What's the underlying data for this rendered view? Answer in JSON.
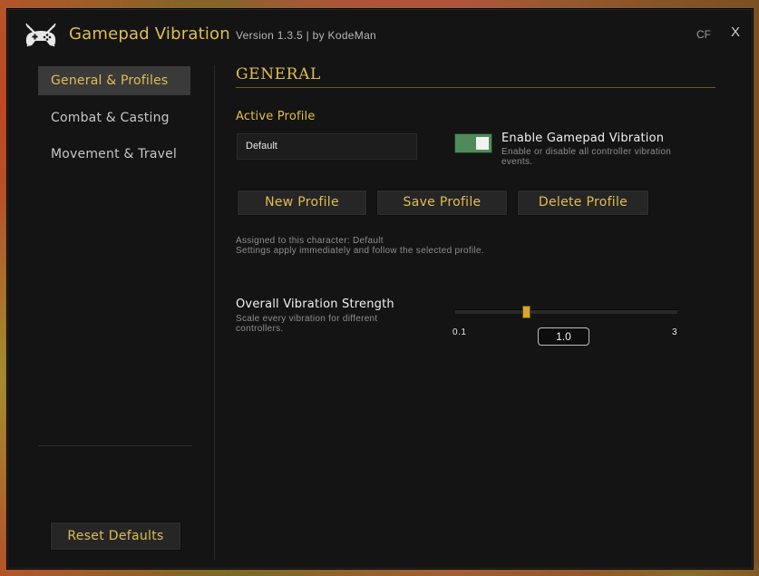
{
  "window": {
    "title": "Gamepad Vibration",
    "version": "Version 1.3.5  |  by KodeMan",
    "cf_label": "CF",
    "close_label": "X"
  },
  "sidebar": {
    "items": [
      {
        "label": "General & Profiles",
        "active": true
      },
      {
        "label": "Combat & Casting",
        "active": false
      },
      {
        "label": "Movement & Travel",
        "active": false
      }
    ],
    "reset_label": "Reset Defaults"
  },
  "main": {
    "section_title": "GENERAL",
    "active_profile_label": "Active Profile",
    "profile_value": "Default",
    "toggle": {
      "title": "Enable Gamepad Vibration",
      "description": "Enable or disable all controller vibration events.",
      "enabled": true
    },
    "buttons": {
      "new": "New Profile",
      "save": "Save Profile",
      "delete": "Delete Profile"
    },
    "info": {
      "assigned": "Assigned to this character: Default",
      "note": "Settings apply immediately and follow the selected profile."
    },
    "strength": {
      "title": "Overall Vibration Strength",
      "description": "Scale every vibration for different controllers.",
      "min": "0.1",
      "max": "3",
      "value": "1.0"
    }
  },
  "colors": {
    "accent_gold": "#e0bd52",
    "toggle_green": "#4f8b5a",
    "panel_bg": "#141414"
  },
  "icons": {
    "logo": "gamepad-crossed-icon"
  }
}
